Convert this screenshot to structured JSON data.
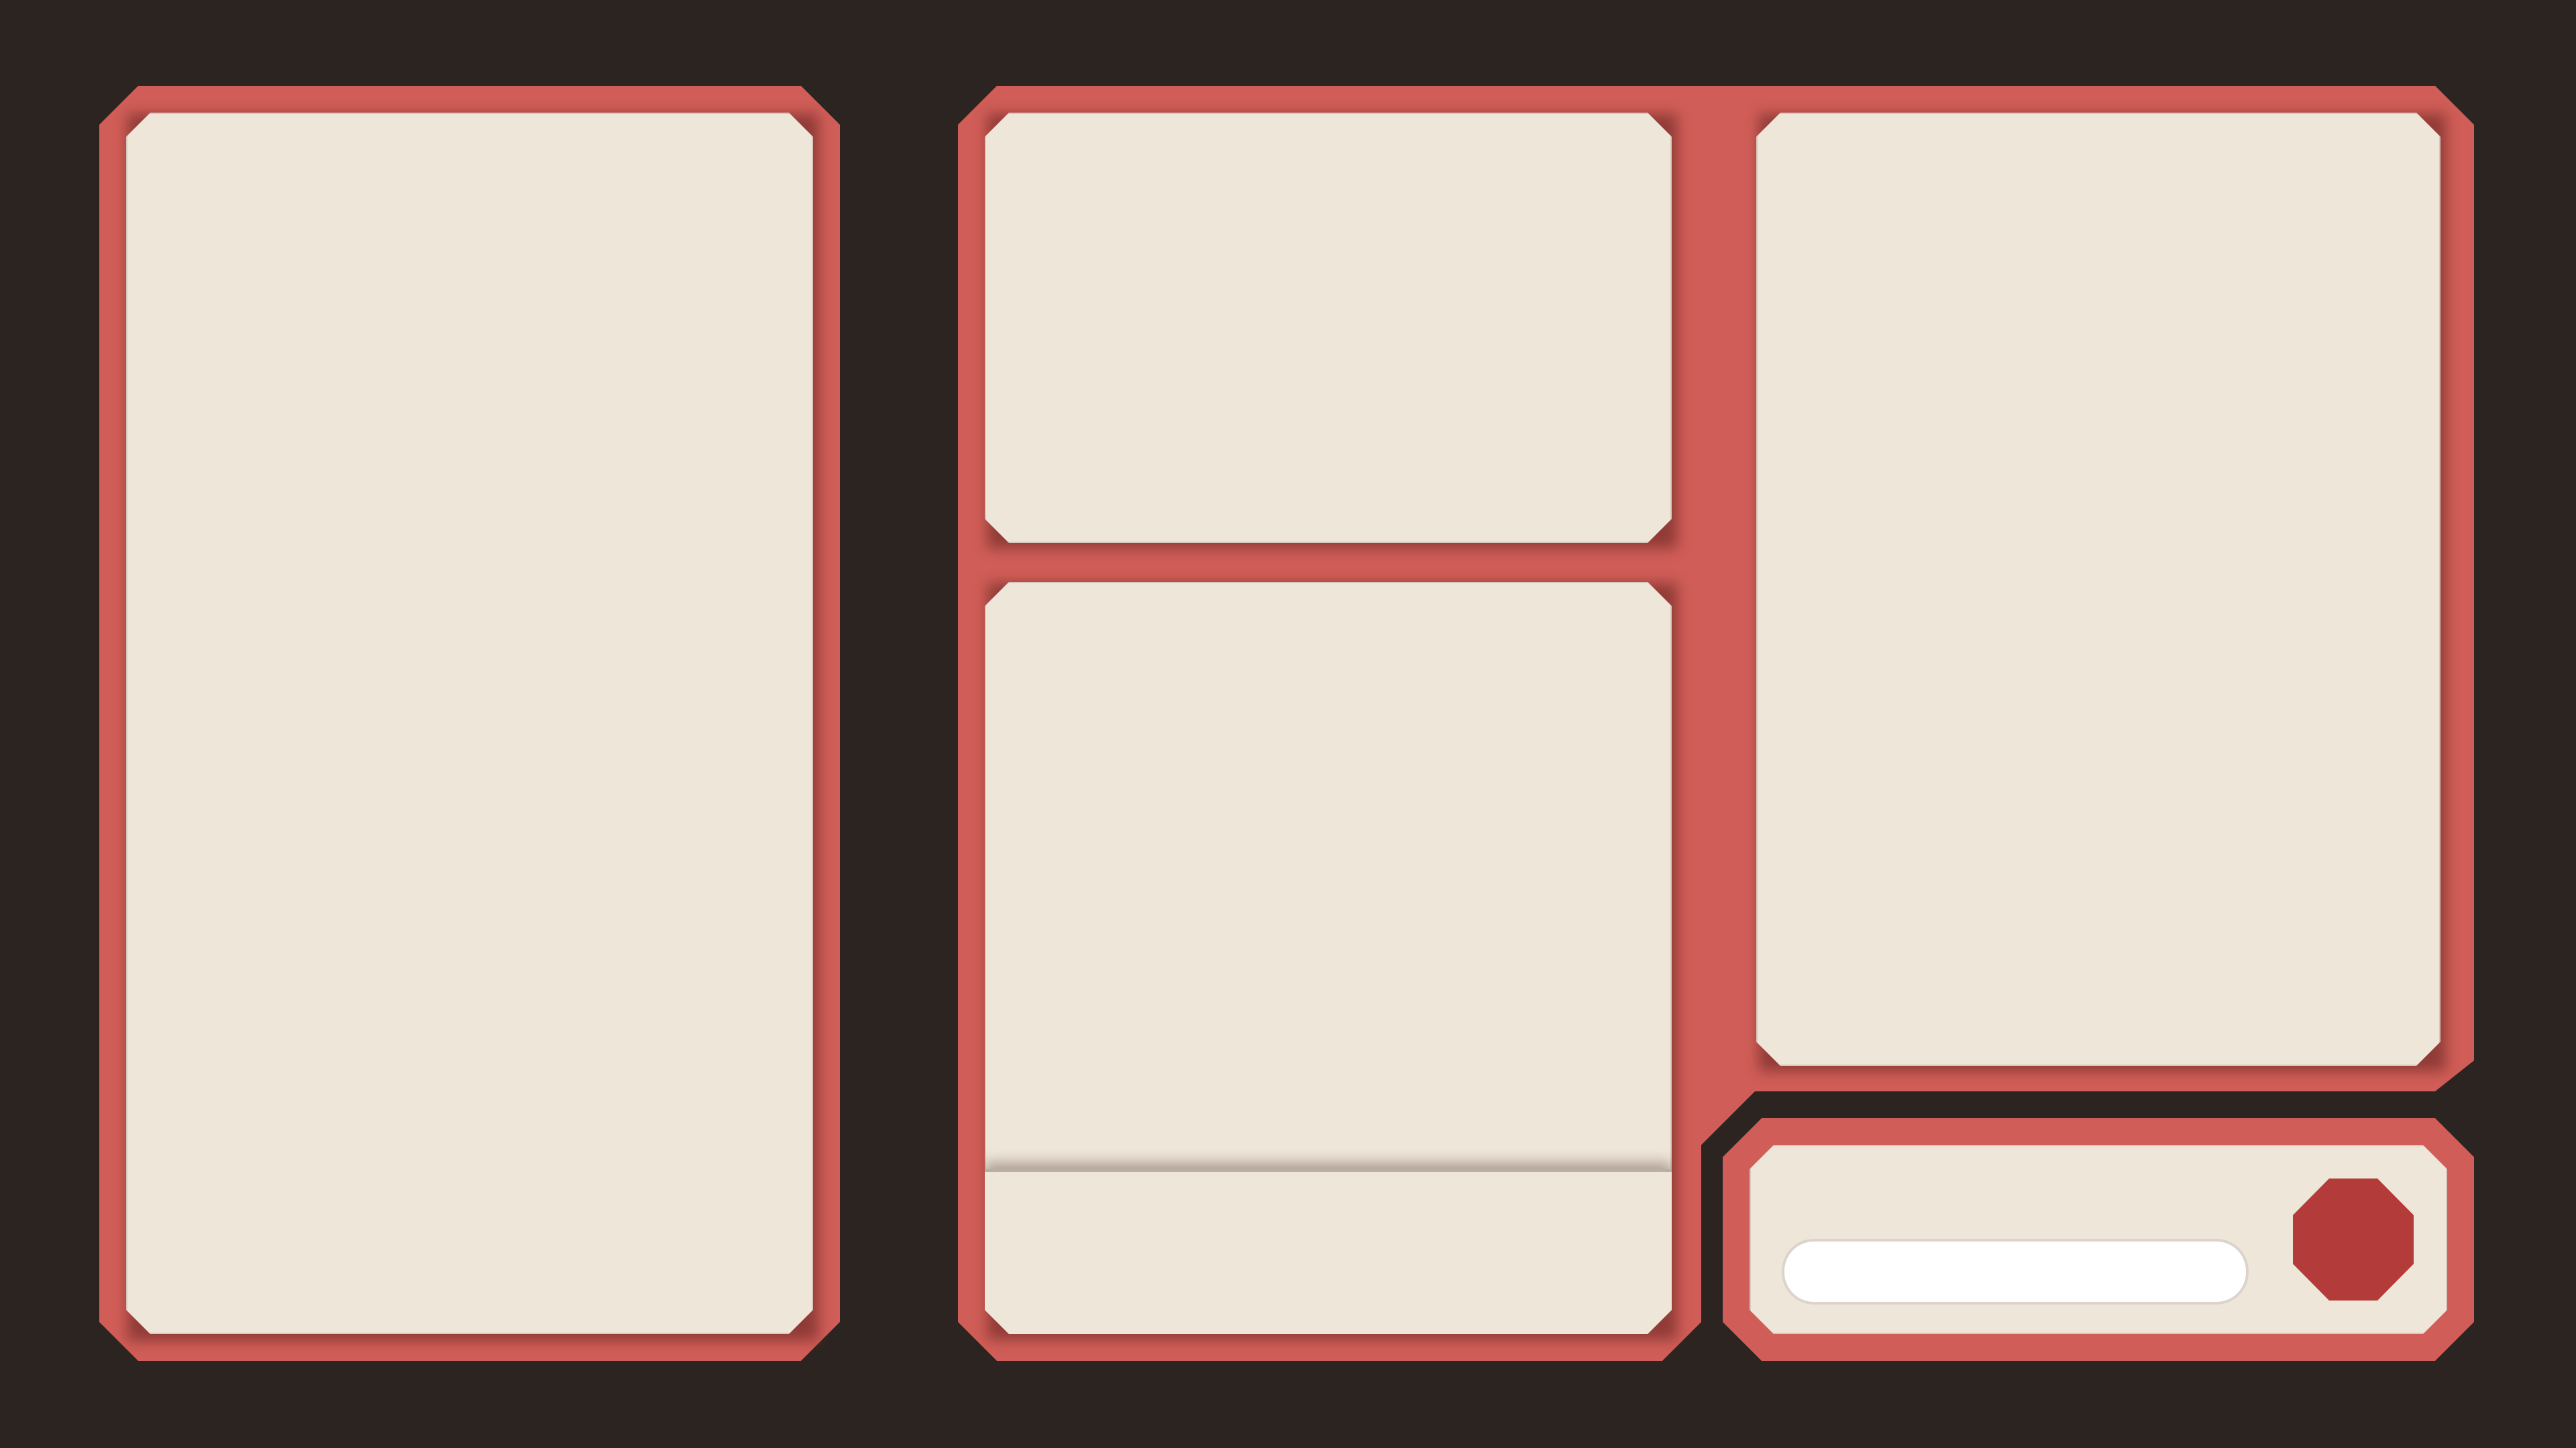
{
  "app": {
    "title": ""
  },
  "colors": {
    "background": "#2c2420",
    "frame": "#d05d57",
    "panel": "#eee6d9",
    "button": "#b33c3a"
  },
  "panels": {
    "left": {
      "content": ""
    },
    "middle_top": {
      "content": ""
    },
    "middle_bottom": {
      "content": "",
      "footer": ""
    },
    "right_top": {
      "content": ""
    }
  },
  "input_bar": {
    "value": "",
    "placeholder": "",
    "button_icon": "octagon-icon"
  }
}
